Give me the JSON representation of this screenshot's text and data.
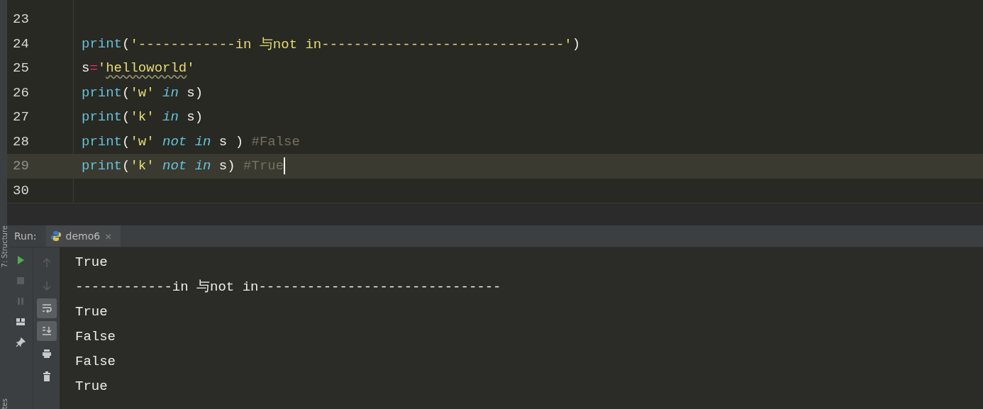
{
  "editor": {
    "lines": [
      {
        "number": "23",
        "current": false
      },
      {
        "number": "24",
        "current": false,
        "tokens": [
          {
            "kind": "func",
            "text": "print"
          },
          {
            "kind": "punct",
            "text": "("
          },
          {
            "kind": "string",
            "text": "'------------in 与not in------------------------------'"
          },
          {
            "kind": "punct",
            "text": ")"
          }
        ]
      },
      {
        "number": "25",
        "current": false,
        "tokens": [
          {
            "kind": "ident",
            "text": "s"
          },
          {
            "kind": "operator",
            "text": "="
          },
          {
            "kind": "string",
            "text": "'"
          },
          {
            "kind": "typo",
            "text": "helloworld"
          },
          {
            "kind": "string",
            "text": "'"
          }
        ]
      },
      {
        "number": "26",
        "current": false,
        "tokens": [
          {
            "kind": "func",
            "text": "print"
          },
          {
            "kind": "punct",
            "text": "("
          },
          {
            "kind": "string",
            "text": "'w'"
          },
          {
            "kind": "keyword",
            "text": " in"
          },
          {
            "kind": "ident",
            "text": " s)"
          }
        ]
      },
      {
        "number": "27",
        "current": false,
        "tokens": [
          {
            "kind": "func",
            "text": "print"
          },
          {
            "kind": "punct",
            "text": "("
          },
          {
            "kind": "string",
            "text": "'k'"
          },
          {
            "kind": "keyword",
            "text": " in"
          },
          {
            "kind": "ident",
            "text": " s)"
          }
        ]
      },
      {
        "number": "28",
        "current": false,
        "tokens": [
          {
            "kind": "func",
            "text": "print"
          },
          {
            "kind": "punct",
            "text": "("
          },
          {
            "kind": "string",
            "text": "'w'"
          },
          {
            "kind": "keyword",
            "text": " not in"
          },
          {
            "kind": "ident",
            "text": " s ) "
          },
          {
            "kind": "comment",
            "text": "#False"
          }
        ]
      },
      {
        "number": "29",
        "current": true,
        "tokens": [
          {
            "kind": "func",
            "text": "print"
          },
          {
            "kind": "punct",
            "text": "("
          },
          {
            "kind": "string",
            "text": "'k'"
          },
          {
            "kind": "keyword",
            "text": " not in"
          },
          {
            "kind": "ident",
            "text": " s) "
          },
          {
            "kind": "comment",
            "text": "#True"
          }
        ]
      },
      {
        "number": "30",
        "current": false
      }
    ]
  },
  "side_labels": [
    "7: Structure",
    "tes"
  ],
  "run_panel": {
    "label": "Run:",
    "tab": {
      "title": "demo6",
      "close": "×"
    },
    "toolbar_left": [
      {
        "kind": "run"
      },
      {
        "kind": "stop"
      },
      {
        "kind": "pause"
      },
      {
        "kind": "layout"
      },
      {
        "kind": "pin"
      }
    ],
    "toolbar_right": [
      {
        "kind": "up",
        "on": false
      },
      {
        "kind": "down",
        "on": false
      },
      {
        "kind": "wrap",
        "on": true
      },
      {
        "kind": "scroll-end",
        "on": true
      },
      {
        "kind": "print",
        "on": false
      },
      {
        "kind": "trash",
        "on": false
      }
    ],
    "output": [
      "True",
      "------------in 与not in------------------------------",
      "True",
      "False",
      "False",
      "True"
    ]
  }
}
